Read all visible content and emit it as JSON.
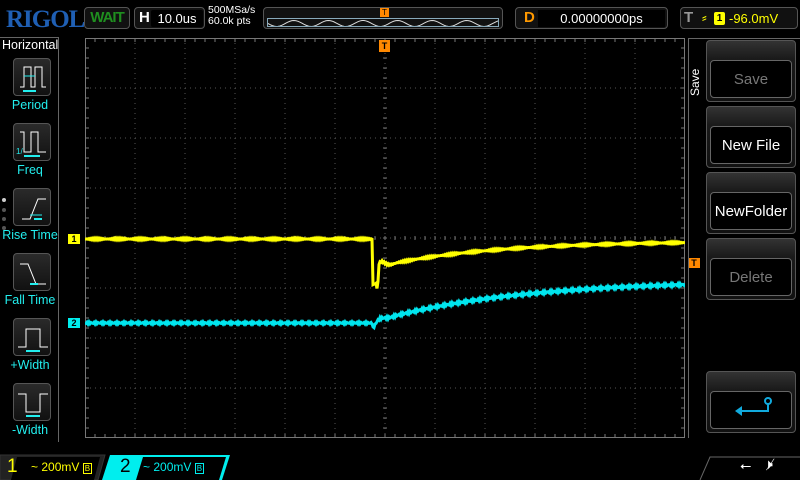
{
  "header": {
    "logo": "RIGOL",
    "run_status": "WAIT",
    "timebase_key": "H",
    "timebase": "10.0us",
    "sample_rate": "500MSa/s",
    "memory_depth": "60.0k pts",
    "delay_key": "D",
    "delay": "0.00000000ps",
    "trigger_key": "T",
    "trigger_channel": "1",
    "trigger_level": "-96.0mV"
  },
  "left_menu": {
    "title": "Horizontal",
    "items": [
      {
        "label": "Period"
      },
      {
        "label": "Freq"
      },
      {
        "label": "Rise Time"
      },
      {
        "label": "Fall Time"
      },
      {
        "label": "+Width"
      },
      {
        "label": "-Width"
      }
    ]
  },
  "right_menu": {
    "title": "Save",
    "buttons": [
      {
        "label": "Save",
        "enabled": false
      },
      {
        "label": "New File",
        "enabled": true
      },
      {
        "label": "NewFolder",
        "enabled": true
      },
      {
        "label": "Delete",
        "enabled": false
      }
    ]
  },
  "channels": [
    {
      "number": "1",
      "coupling": "~",
      "scale": "200mV",
      "color": "#ffff00"
    },
    {
      "number": "2",
      "coupling": "~",
      "scale": "200mV",
      "color": "#00e5ee"
    }
  ],
  "markers": {
    "ch1": "1",
    "ch2": "2",
    "trigger": "T"
  }
}
